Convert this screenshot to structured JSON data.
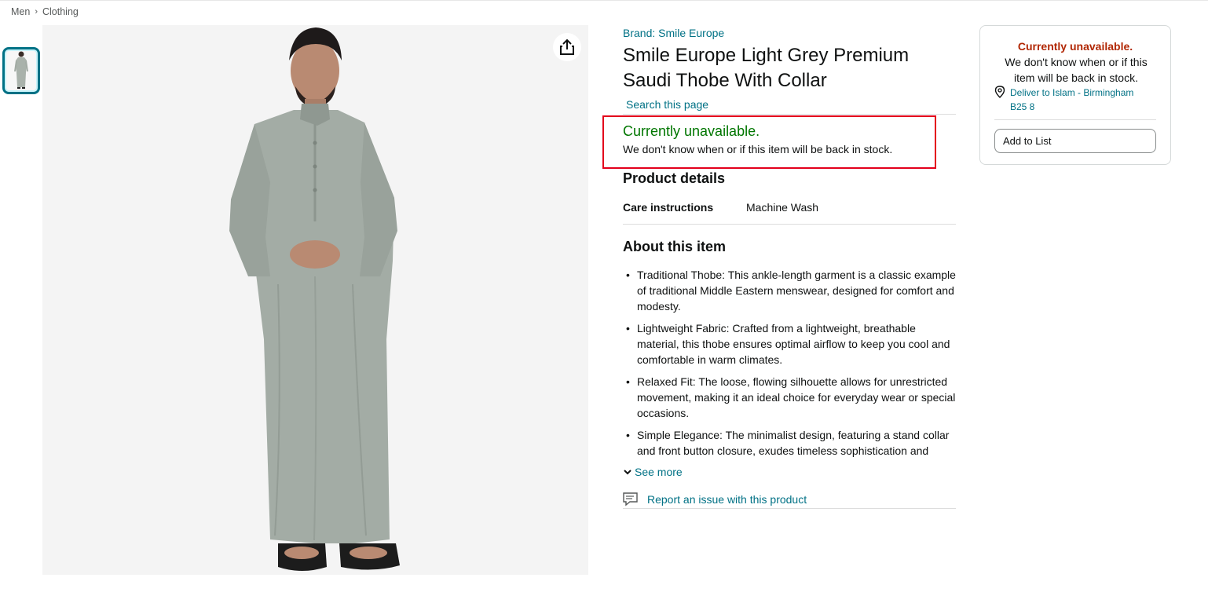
{
  "breadcrumb": {
    "items": [
      "Men",
      "Clothing"
    ],
    "separator": "›"
  },
  "gallery": {
    "thumbnail_icon": "thobe-thumbnail-icon",
    "main_image_icon": "man-in-grey-thobe-photo",
    "share_icon": "share-icon"
  },
  "product": {
    "brand_link": "Brand: Smile Europe",
    "title": "Smile Europe Light Grey Premium Saudi Thobe With Collar",
    "search_link": "Search this page"
  },
  "availability": {
    "title": "Currently unavailable.",
    "message": "We don't know when or if this item will be back in stock."
  },
  "details": {
    "heading": "Product details",
    "care_label": "Care instructions",
    "care_value": "Machine Wash"
  },
  "about": {
    "heading": "About this item",
    "bullets": [
      "Traditional Thobe: This ankle-length garment is a classic example of traditional Middle Eastern menswear, designed for comfort and modesty.",
      "Lightweight Fabric: Crafted from a lightweight, breathable material, this thobe ensures optimal airflow to keep you cool and comfortable in warm climates.",
      "Relaxed Fit: The loose, flowing silhouette allows for unrestricted movement, making it an ideal choice for everyday wear or special occasions.",
      "Simple Elegance: The minimalist design, featuring a stand collar and front button closure, exudes timeless sophistication and"
    ],
    "see_more": "See more",
    "report": "Report an issue with this product"
  },
  "buybox": {
    "title": "Currently unavailable.",
    "message": "We don't know when or if this item will be back in stock.",
    "deliver": "Deliver to Islam - Birmingham B25 8",
    "add_to_list": "Add to List"
  },
  "colors": {
    "link": "#007185",
    "in_stock_green": "#007600",
    "unavailable_red": "#b12704",
    "highlight_border": "#e3001b"
  }
}
